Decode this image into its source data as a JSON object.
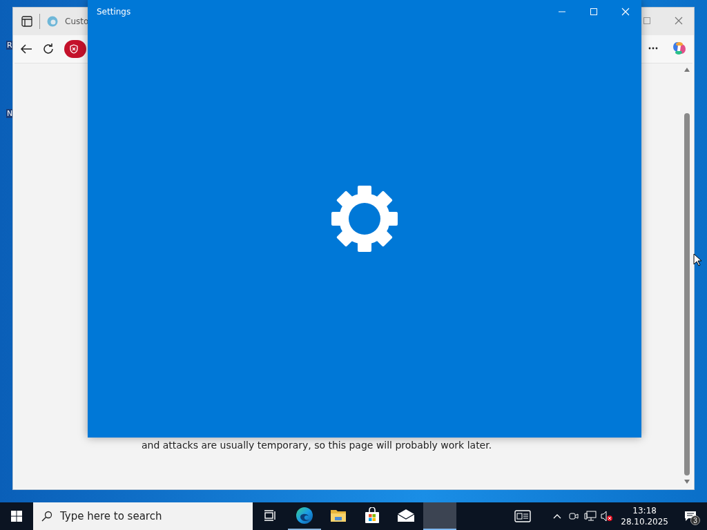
{
  "desktop": {
    "icon_labels": [
      "R",
      "N"
    ]
  },
  "browser": {
    "tab_title": "Custo",
    "page_text": "and attacks are usually temporary, so this page will probably work later."
  },
  "settings_window": {
    "title": "Settings"
  },
  "taskbar": {
    "search": {
      "placeholder": "Type here to search"
    },
    "apps": [
      {
        "kind": "task-view",
        "running": false,
        "selected": false
      },
      {
        "kind": "edge",
        "running": true,
        "selected": false
      },
      {
        "kind": "explorer",
        "running": false,
        "selected": false
      },
      {
        "kind": "store",
        "running": false,
        "selected": false
      },
      {
        "kind": "mail",
        "running": false,
        "selected": false
      },
      {
        "kind": "settings",
        "running": true,
        "selected": true
      }
    ],
    "volume": {
      "muted": true
    },
    "clock": {
      "time": "13:18",
      "date": "28.10.2025"
    },
    "notifications": {
      "count": "3"
    }
  }
}
